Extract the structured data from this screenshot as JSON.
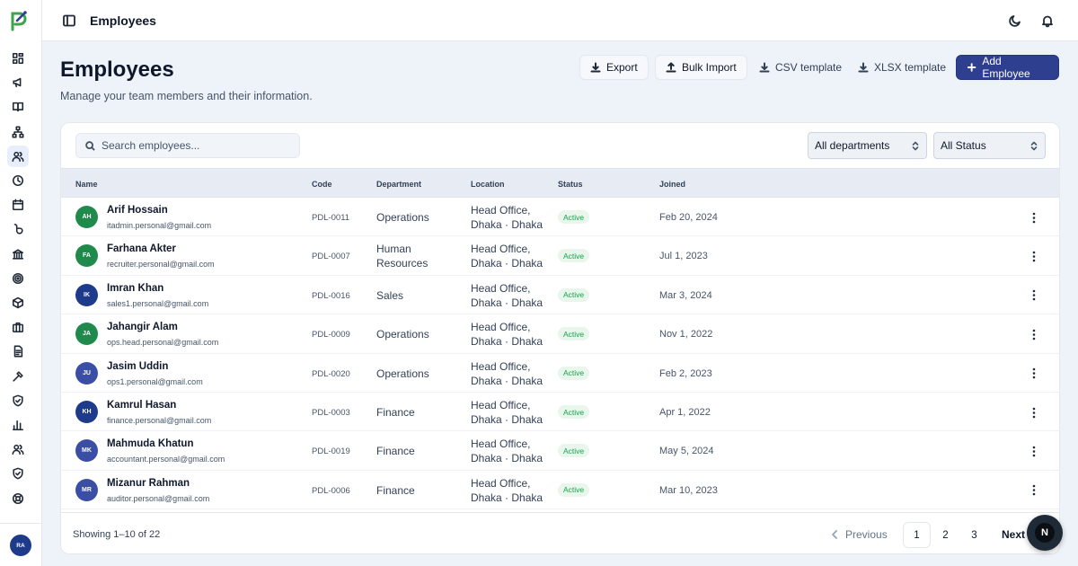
{
  "topbar": {
    "title": "Employees",
    "icons": [
      "sidebar-toggle-icon",
      "moon-icon",
      "bell-icon"
    ]
  },
  "sidebar": {
    "logo": "p-logo",
    "items": [
      {
        "icon": "dashboard-icon",
        "active": false
      },
      {
        "icon": "megaphone-icon",
        "active": false
      },
      {
        "icon": "book-icon",
        "active": false
      },
      {
        "icon": "org-chart-icon",
        "active": false
      },
      {
        "icon": "users-icon",
        "active": true
      },
      {
        "icon": "clock-icon",
        "active": false
      },
      {
        "icon": "calendar-icon",
        "active": false
      },
      {
        "icon": "currency-icon",
        "active": false
      },
      {
        "icon": "bank-icon",
        "active": false
      },
      {
        "icon": "target-icon",
        "active": false
      },
      {
        "icon": "box-icon",
        "active": false
      },
      {
        "icon": "briefcase-icon",
        "active": false
      },
      {
        "icon": "document-icon",
        "active": false
      },
      {
        "icon": "hammer-icon",
        "active": false
      },
      {
        "icon": "shield-check-icon",
        "active": false
      },
      {
        "icon": "bar-chart-icon",
        "active": false
      },
      {
        "icon": "users-icon",
        "active": false
      },
      {
        "icon": "shield-icon",
        "active": false
      },
      {
        "icon": "lifebuoy-icon",
        "active": false
      }
    ],
    "user_initials": "RA"
  },
  "header": {
    "title": "Employees",
    "subtitle": "Manage your team members and their information.",
    "actions": {
      "export": "Export",
      "bulk_import": "Bulk Import",
      "csv_template": "CSV template",
      "xlsx_template": "XLSX template",
      "add_employee": "Add Employee"
    }
  },
  "filters": {
    "search_placeholder": "Search employees...",
    "department": "All departments",
    "status": "All Status"
  },
  "table": {
    "columns": [
      "Name",
      "Code",
      "Department",
      "Location",
      "Status",
      "Joined"
    ],
    "rows": [
      {
        "initials": "AH",
        "name": "Arif Hossain",
        "email": "itadmin.personal@gmail.com",
        "code": "PDL-0011",
        "department": "Operations",
        "location": "Head Office, Dhaka · Dhaka",
        "status": "Active",
        "joined": "Feb 20, 2024",
        "avatar_color": "#1f8a4c"
      },
      {
        "initials": "FA",
        "name": "Farhana Akter",
        "email": "recruiter.personal@gmail.com",
        "code": "PDL-0007",
        "department": "Human Resources",
        "location": "Head Office, Dhaka · Dhaka",
        "status": "Active",
        "joined": "Jul 1, 2023",
        "avatar_color": "#1f8a4c"
      },
      {
        "initials": "IK",
        "name": "Imran Khan",
        "email": "sales1.personal@gmail.com",
        "code": "PDL-0016",
        "department": "Sales",
        "location": "Head Office, Dhaka · Dhaka",
        "status": "Active",
        "joined": "Mar 3, 2024",
        "avatar_color": "#1e3a8a"
      },
      {
        "initials": "JA",
        "name": "Jahangir Alam",
        "email": "ops.head.personal@gmail.com",
        "code": "PDL-0009",
        "department": "Operations",
        "location": "Head Office, Dhaka · Dhaka",
        "status": "Active",
        "joined": "Nov 1, 2022",
        "avatar_color": "#1f8a4c"
      },
      {
        "initials": "JU",
        "name": "Jasim Uddin",
        "email": "ops1.personal@gmail.com",
        "code": "PDL-0020",
        "department": "Operations",
        "location": "Head Office, Dhaka · Dhaka",
        "status": "Active",
        "joined": "Feb 2, 2023",
        "avatar_color": "#3b4ea6"
      },
      {
        "initials": "KH",
        "name": "Kamrul Hasan",
        "email": "finance.personal@gmail.com",
        "code": "PDL-0003",
        "department": "Finance",
        "location": "Head Office, Dhaka · Dhaka",
        "status": "Active",
        "joined": "Apr 1, 2022",
        "avatar_color": "#1e3a8a"
      },
      {
        "initials": "MK",
        "name": "Mahmuda Khatun",
        "email": "accountant.personal@gmail.com",
        "code": "PDL-0019",
        "department": "Finance",
        "location": "Head Office, Dhaka · Dhaka",
        "status": "Active",
        "joined": "May 5, 2024",
        "avatar_color": "#3b4ea6"
      },
      {
        "initials": "MR",
        "name": "Mizanur Rahman",
        "email": "auditor.personal@gmail.com",
        "code": "PDL-0006",
        "department": "Finance",
        "location": "Head Office, Dhaka · Dhaka",
        "status": "Active",
        "joined": "Mar 10, 2023",
        "avatar_color": "#3b4ea6"
      }
    ]
  },
  "pagination": {
    "summary": "Showing 1–10 of 22",
    "previous": "Previous",
    "pages": [
      "1",
      "2",
      "3"
    ],
    "current_page": "1",
    "next": "Next"
  },
  "fab": {
    "label": "N"
  },
  "colors": {
    "primary": "#2f3f8f",
    "background": "#eef2f9",
    "status_active_bg": "#e8f6ec",
    "status_active_text": "#16a34a"
  }
}
